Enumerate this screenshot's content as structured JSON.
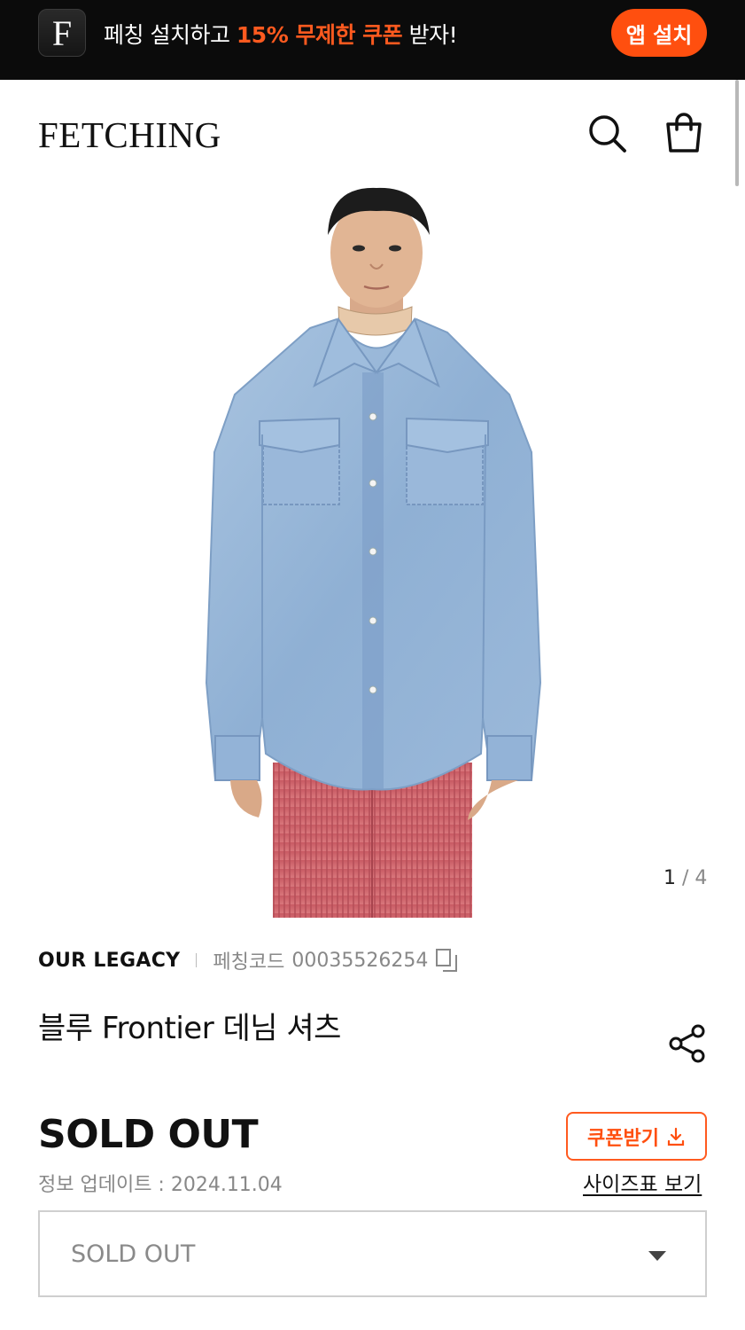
{
  "promo": {
    "logo_letter": "F",
    "text_prefix": "페칭 설치하고 ",
    "text_highlight": "15% 무제한 쿠폰",
    "text_suffix": " 받자!",
    "install_button": "앱 설치",
    "accent_color": "#ff4f0f"
  },
  "header": {
    "brand": "FETCHING",
    "icons": [
      "search-icon",
      "shopping-bag-icon"
    ]
  },
  "gallery": {
    "current": "1",
    "separator": "/",
    "total": "4"
  },
  "product": {
    "brand": "OUR LEGACY",
    "code_label": "페칭코드",
    "code_value": "00035526254",
    "title": "블루 Frontier 데님 셔츠",
    "price_status": "SOLD OUT",
    "update_info": "정보 업데이트 : 2024.11.04",
    "coupon_button": "쿠폰받기",
    "size_chart_link": "사이즈표 보기",
    "option_select_value": "SOLD OUT"
  }
}
